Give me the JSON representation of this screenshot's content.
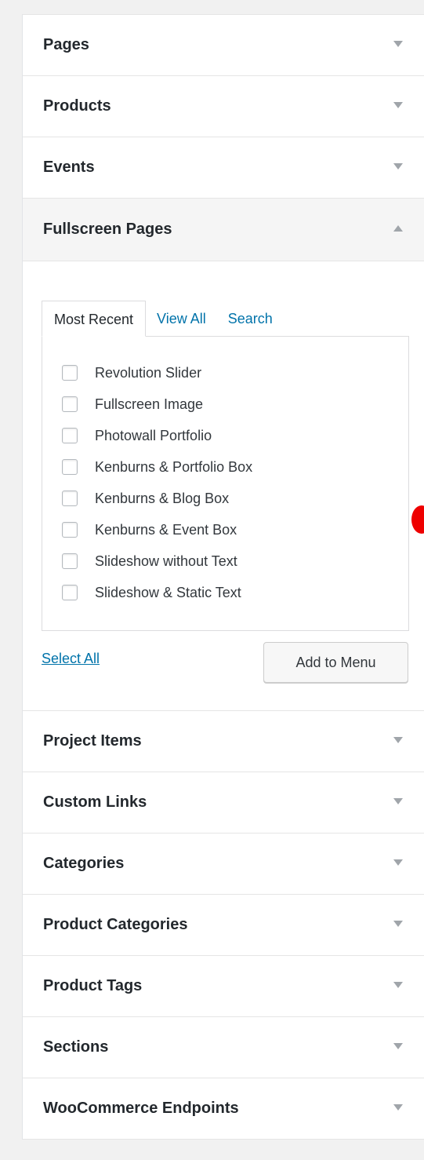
{
  "sections_top": [
    {
      "label": "Pages"
    },
    {
      "label": "Products"
    },
    {
      "label": "Events"
    }
  ],
  "open_section": {
    "label": "Fullscreen Pages",
    "tabs": [
      {
        "label": "Most Recent",
        "active": true
      },
      {
        "label": "View All",
        "active": false
      },
      {
        "label": "Search",
        "active": false
      }
    ],
    "items": [
      {
        "label": "Revolution Slider",
        "checked": false
      },
      {
        "label": "Fullscreen Image",
        "checked": false
      },
      {
        "label": "Photowall Portfolio",
        "checked": false
      },
      {
        "label": "Kenburns & Portfolio Box",
        "checked": false
      },
      {
        "label": "Kenburns & Blog Box",
        "checked": false
      },
      {
        "label": "Kenburns & Event Box",
        "checked": false
      },
      {
        "label": "Slideshow without Text",
        "checked": false
      },
      {
        "label": "Slideshow & Static Text",
        "checked": false
      }
    ],
    "select_all_label": "Select All",
    "add_button_label": "Add to Menu"
  },
  "sections_bottom": [
    {
      "label": "Project Items"
    },
    {
      "label": "Custom Links"
    },
    {
      "label": "Categories"
    },
    {
      "label": "Product Categories"
    },
    {
      "label": "Product Tags"
    },
    {
      "label": "Sections"
    },
    {
      "label": "WooCommerce Endpoints"
    }
  ],
  "colors": {
    "link": "#0073aa",
    "marker": "#ee0000"
  }
}
